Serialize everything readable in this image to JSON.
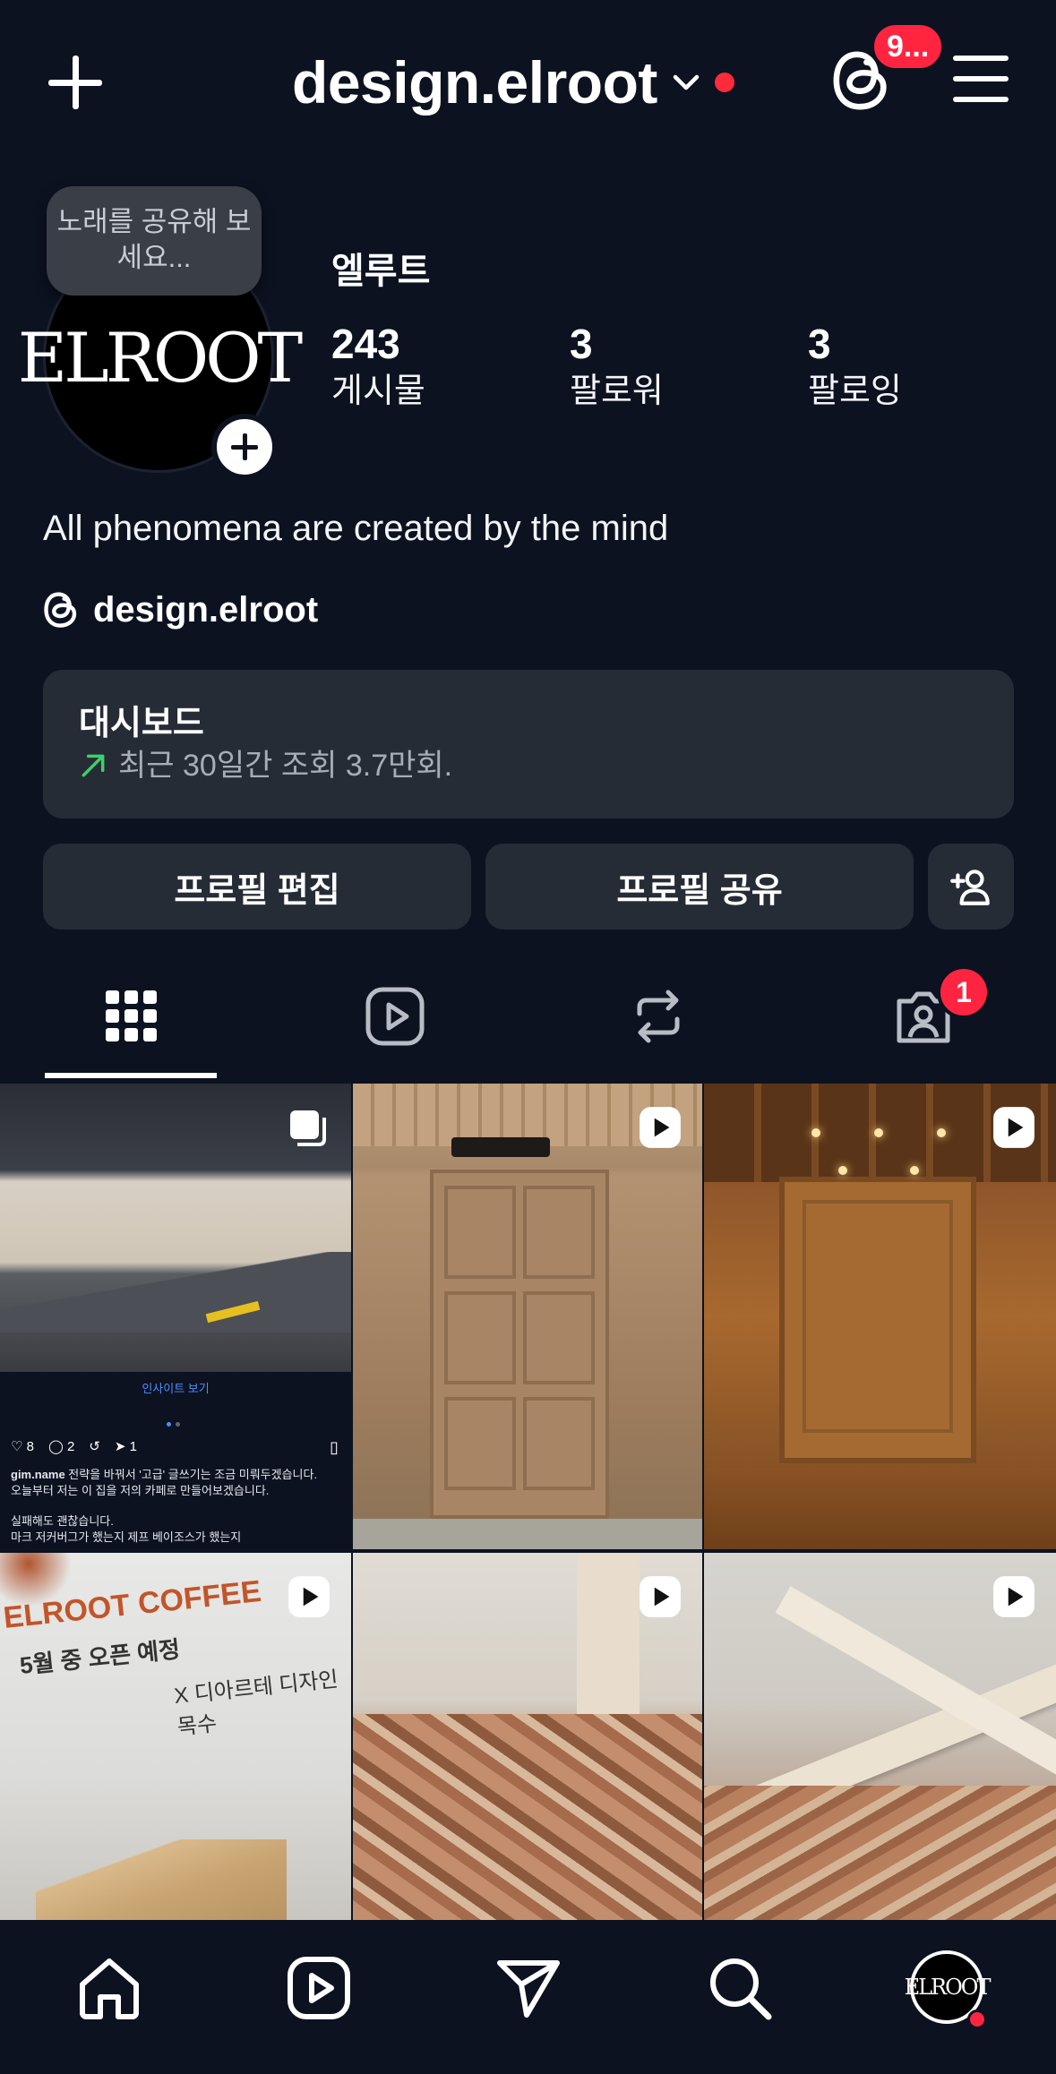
{
  "header": {
    "username": "design.elroot",
    "notification_badge": "9..."
  },
  "profile": {
    "note_bubble": "노래를 공유해 보세요...",
    "avatar_logo": "ELROOT",
    "display_name": "엘루트",
    "stats": [
      {
        "count": "243",
        "label": "게시물"
      },
      {
        "count": "3",
        "label": "팔로워"
      },
      {
        "count": "3",
        "label": "팔로잉"
      }
    ],
    "bio": "All phenomena are created by the mind",
    "threads_handle": "design.elroot"
  },
  "dashboard": {
    "title": "대시보드",
    "subtitle": "최근 30일간 조회 3.7만회."
  },
  "buttons": {
    "edit_profile": "프로필 편집",
    "share_profile": "프로필 공유"
  },
  "tabs": {
    "tagged_badge": "1"
  },
  "grid": {
    "post1": {
      "insight_link": "인사이트 보기",
      "likes": "8",
      "comments": "2",
      "shares": "1",
      "caption_user": "gim.name",
      "caption_line1": " 전략을 바꿔서 '고급' 글쓰기는 조금 미뤄두겠습니다.",
      "caption_line2": "오늘부터 저는 이 집을 저의 카페로 만들어보겠습니다.",
      "caption_line3": "실패해도 괜찮습니다.",
      "caption_line4": "마크 저커버그가 했는지 제프 베이조스가 했는지"
    },
    "post4": {
      "sign_brand": "ELROOT COFFEE",
      "sign_open": "5월 중 오픈 예정",
      "sign_collab": "X 디아르테 디자인 목수"
    }
  },
  "bottom_nav": {
    "avatar_logo": "ELROOT"
  },
  "colors": {
    "background": "#0c1220",
    "card": "#262c36",
    "badge": "#ff2540",
    "trend": "#3fd06a"
  }
}
